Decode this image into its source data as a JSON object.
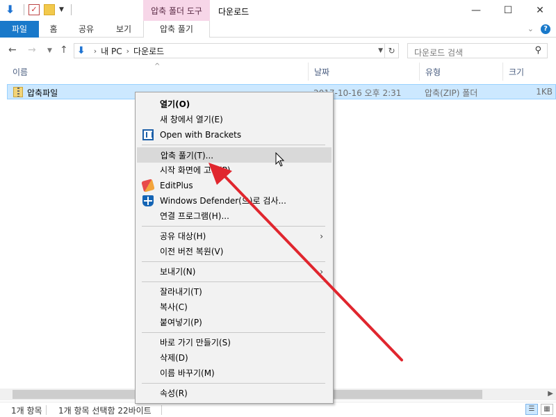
{
  "window": {
    "title": "다운로드",
    "tool_tab_group": "압축 폴더 도구",
    "controls": {
      "minimize": "—",
      "maximize": "☐",
      "close": "✕"
    }
  },
  "ribbon": {
    "tabs": [
      "파일",
      "홈",
      "공유",
      "보기",
      "압축 풀기"
    ],
    "expand_chevron": "⌄",
    "help": "?"
  },
  "address": {
    "breadcrumbs": [
      "내 PC",
      "다운로드"
    ],
    "search_placeholder": "다운로드 검색"
  },
  "columns": [
    "이름",
    "날짜",
    "유형",
    "크기"
  ],
  "files": [
    {
      "name": "압축파일",
      "date": "2017-10-16 오후 2:31",
      "type": "압축(ZIP) 폴더",
      "size": "1KB",
      "selected": true
    }
  ],
  "context_menu": {
    "items": [
      {
        "label": "열기(O)",
        "bold": true
      },
      {
        "label": "새 창에서 열기(E)"
      },
      {
        "label": "Open with Brackets",
        "icon": "brackets-icon"
      },
      {
        "label": "압축 풀기(T)...",
        "hover": true
      },
      {
        "label": "시작 화면에 고정(P)"
      },
      {
        "label": "EditPlus",
        "icon": "editplus-icon"
      },
      {
        "label": "Windows Defender(으)로 검사...",
        "icon": "defender-icon"
      },
      {
        "label": "연결 프로그램(H)..."
      },
      {
        "label": "공유 대상(H)",
        "submenu": true
      },
      {
        "label": "이전 버전 복원(V)"
      },
      {
        "label": "보내기(N)",
        "submenu": true
      },
      {
        "label": "잘라내기(T)"
      },
      {
        "label": "복사(C)"
      },
      {
        "label": "붙여넣기(P)"
      },
      {
        "label": "바로 가기 만들기(S)"
      },
      {
        "label": "삭제(D)"
      },
      {
        "label": "이름 바꾸기(M)"
      },
      {
        "label": "속성(R)"
      }
    ]
  },
  "statusbar": {
    "item_count": "1개 항목",
    "selection": "1개 항목 선택함 22바이트"
  },
  "colors": {
    "accent": "#1979ca",
    "tool_tab": "#f7d6e8",
    "selection": "#cce8ff",
    "annotation_arrow": "#e0262e"
  }
}
